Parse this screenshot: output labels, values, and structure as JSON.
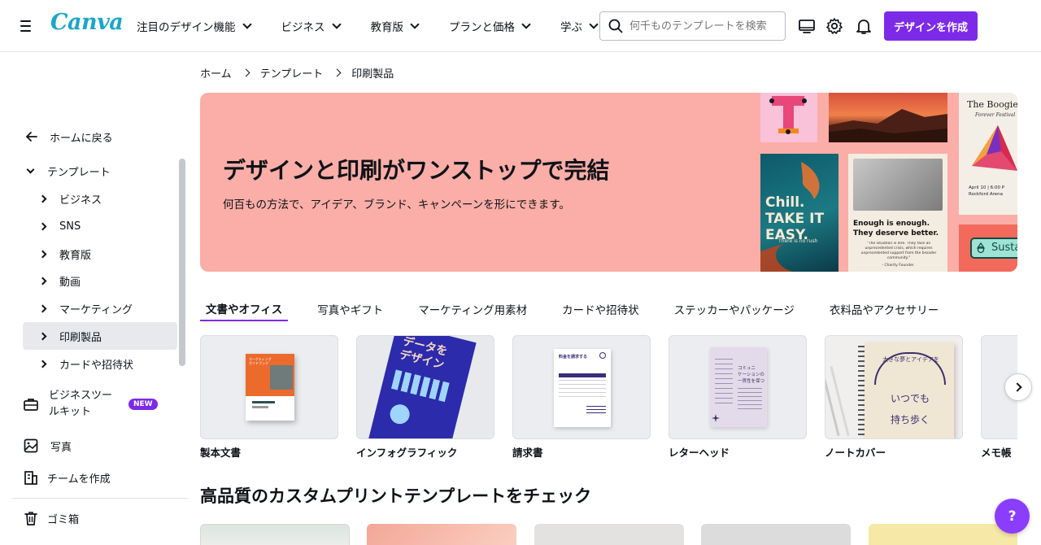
{
  "header": {
    "logo": "Canva",
    "nav": [
      "注目のデザイン機能",
      "ビジネス",
      "教育版",
      "プランと価格",
      "学ぶ"
    ],
    "search_placeholder": "何千ものテンプレートを検索",
    "create_button": "デザインを作成",
    "brand_color": "#7d2ae8"
  },
  "sidebar": {
    "back": "ホームに戻る",
    "templates": "テンプレート",
    "sub_items": [
      "ビジネス",
      "SNS",
      "教育版",
      "動画",
      "マーケティング",
      "印刷製品",
      "カードや招待状"
    ],
    "active_item": "印刷製品",
    "business_tools": "ビジネスツールキット",
    "new_badge": "NEW",
    "photos": "写真",
    "team": "チームを作成",
    "trash": "ゴミ箱"
  },
  "breadcrumb": [
    "ホーム",
    "テンプレート",
    "印刷製品"
  ],
  "hero": {
    "title": "デザインと印刷がワンストップで完結",
    "subtitle": "何百もの方法で、アイデア、ブランド、キャンペーンを形にできます。",
    "background": "#fbada7",
    "tiles": {
      "chill_text": "Chill. TAKE IT EASY.",
      "chill_small": "There is no rush",
      "poster_text": "Enough is enough. They deserve better.",
      "poster_small": "\"The situation is dire. They face an unprecedented crisis, which requires unprecedented support from the broader community.\"",
      "poster_credit": "- Charity Founder",
      "boogie_title": "The Boogie D",
      "boogie_sub": "Forever Festival",
      "boogie_date": "April 10 | 6:00 P",
      "boogie_venue": "Rockford Arena",
      "sustain_text": "Susta"
    }
  },
  "tabs": [
    "文書やオフィス",
    "写真やギフト",
    "マーケティング用素材",
    "カードや招待状",
    "ステッカーやパッケージ",
    "衣料品やアクセサリー"
  ],
  "active_tab": 0,
  "cards": [
    {
      "label": "製本文書",
      "thumb_text": "マーケティング\nガイドブック"
    },
    {
      "label": "インフォグラフィック",
      "thumb_text": "データを\nデザイン"
    },
    {
      "label": "請求書",
      "thumb_text": "料金を請求する"
    },
    {
      "label": "レターヘッド",
      "thumb_text": "コミュニ\nケーションの\n一貫性を保つ"
    },
    {
      "label": "ノートカバー",
      "thumb_text": "いつでも\n持ち歩く",
      "thumb_arc": "大きな夢とアイデアを"
    },
    {
      "label": "メモ帳"
    }
  ],
  "section_title": "高品質のカスタムプリントテンプレートをチェック",
  "help": "?"
}
